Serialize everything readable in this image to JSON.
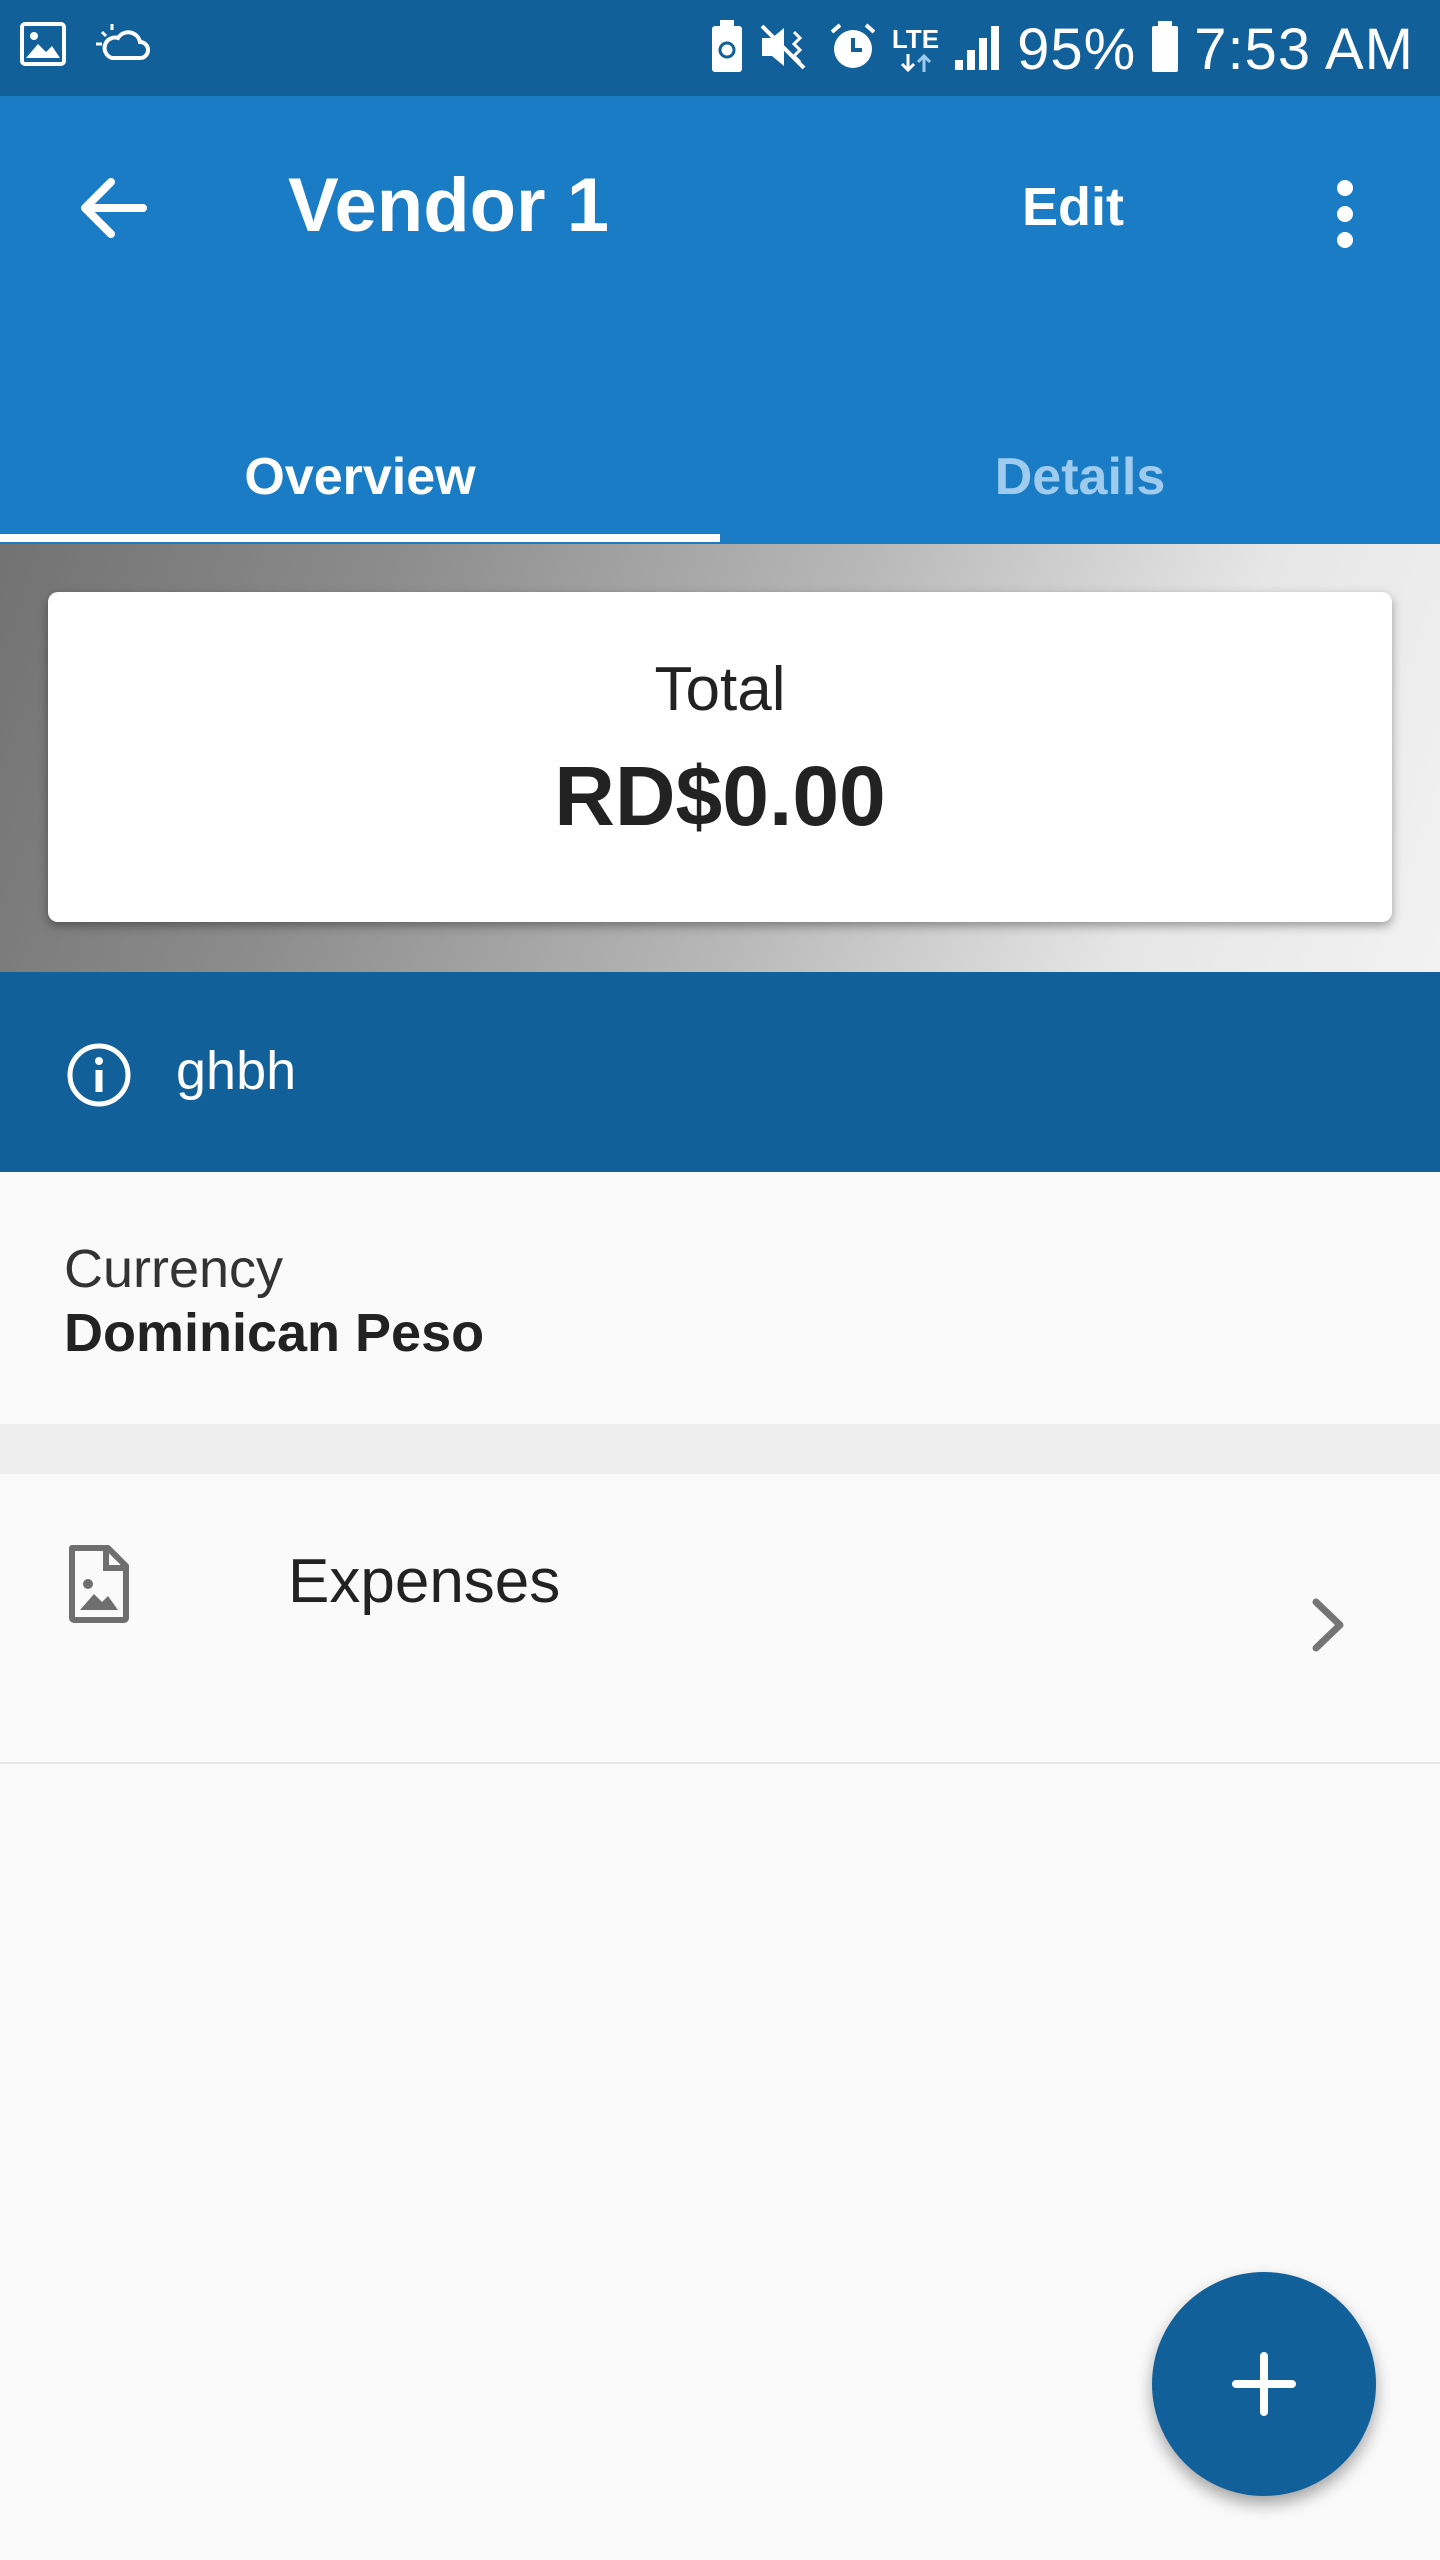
{
  "status_bar": {
    "icons_left": [
      "image-icon",
      "weather-icon"
    ],
    "icons_right": [
      "battery-saver-icon",
      "vibrate-mute-icon",
      "alarm-icon",
      "lte-icon",
      "signal-icon",
      "battery-icon"
    ],
    "lte_label": "LTE",
    "battery_percent": "95%",
    "time": "7:53 AM"
  },
  "app_bar": {
    "title": "Vendor 1",
    "edit_label": "Edit",
    "back_icon": "arrow-back-icon",
    "more_icon": "more-vert-icon",
    "background": "#1a7cc4"
  },
  "tabs": [
    {
      "label": "Overview",
      "selected": true
    },
    {
      "label": "Details",
      "selected": false
    }
  ],
  "summary": {
    "total_label": "Total",
    "total_value": "RD$0.00"
  },
  "info_band": {
    "icon": "info-icon",
    "text": "ghbh",
    "background": "#11609a"
  },
  "currency": {
    "label": "Currency",
    "value": "Dominican Peso"
  },
  "expenses": {
    "icon": "document-image-icon",
    "label": "Expenses",
    "chevron": "chevron-right-icon"
  },
  "fab": {
    "icon": "plus-icon",
    "background": "#11609a"
  }
}
